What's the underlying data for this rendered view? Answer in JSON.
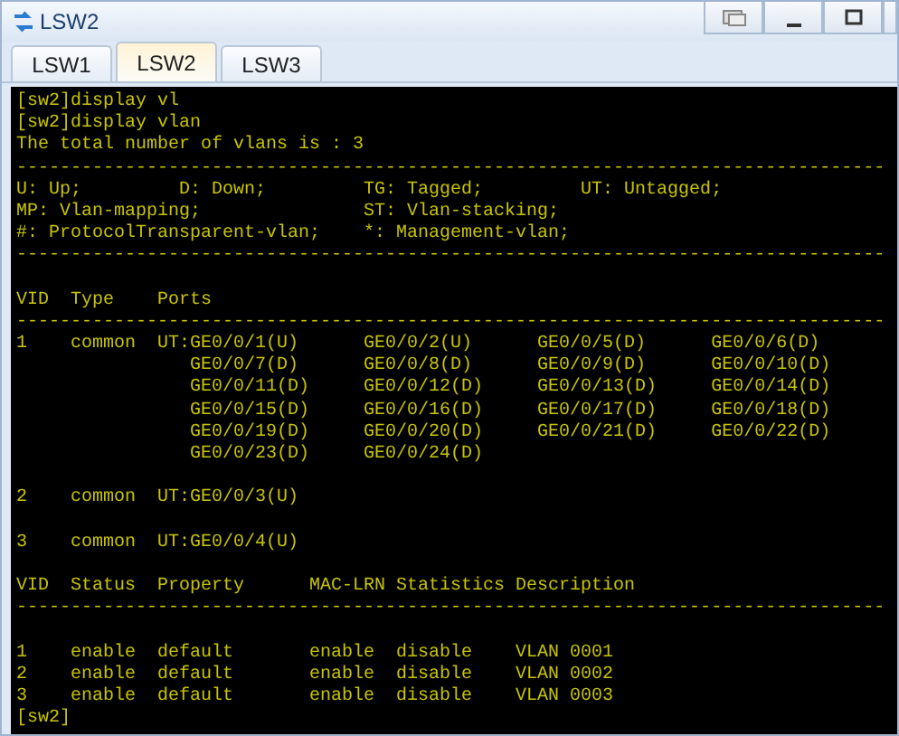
{
  "window": {
    "title": "LSW2"
  },
  "tabs": [
    {
      "label": "LSW1",
      "selected": false
    },
    {
      "label": "LSW2",
      "selected": true
    },
    {
      "label": "LSW3",
      "selected": false
    }
  ],
  "terminal": {
    "blocks": [
      [
        "[sw2]display vl",
        "[sw2]display vlan",
        "The total number of vlans is : 3",
        "--------------------------------------------------------------------------------",
        "U: Up;         D: Down;         TG: Tagged;         UT: Untagged;",
        "MP: Vlan-mapping;               ST: Vlan-stacking;",
        "#: ProtocolTransparent-vlan;    *: Management-vlan;",
        "--------------------------------------------------------------------------------"
      ],
      [
        "VID  Type    Ports",
        "--------------------------------------------------------------------------------",
        "1    common  UT:GE0/0/1(U)      GE0/0/2(U)      GE0/0/5(D)      GE0/0/6(D)",
        "                GE0/0/7(D)      GE0/0/8(D)      GE0/0/9(D)      GE0/0/10(D)",
        "                GE0/0/11(D)     GE0/0/12(D)     GE0/0/13(D)     GE0/0/14(D)",
        "                GE0/0/15(D)     GE0/0/16(D)     GE0/0/17(D)     GE0/0/18(D)",
        "                GE0/0/19(D)     GE0/0/20(D)     GE0/0/21(D)     GE0/0/22(D)",
        "                GE0/0/23(D)     GE0/0/24(D)"
      ],
      [
        "2    common  UT:GE0/0/3(U)"
      ],
      [
        "3    common  UT:GE0/0/4(U)"
      ],
      [
        "VID  Status  Property      MAC-LRN Statistics Description",
        "--------------------------------------------------------------------------------"
      ],
      [
        "1    enable  default       enable  disable    VLAN 0001",
        "2    enable  default       enable  disable    VLAN 0002",
        "3    enable  default       enable  disable    VLAN 0003",
        "[sw2]"
      ]
    ]
  }
}
